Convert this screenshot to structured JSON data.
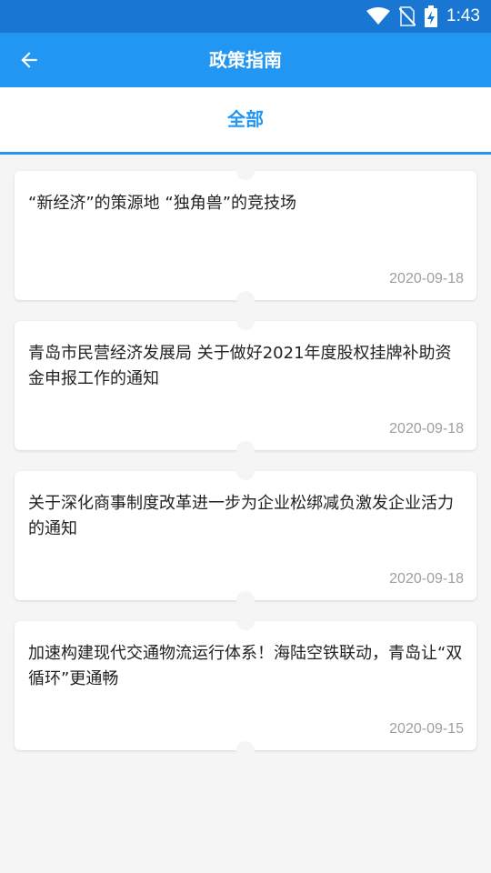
{
  "status_bar": {
    "time": "1:43"
  },
  "app_bar": {
    "title": "政策指南"
  },
  "tabs": [
    {
      "label": "全部"
    }
  ],
  "articles": [
    {
      "title": "“新经济”的策源地 “独角兽”的竞技场",
      "date": "2020-09-18"
    },
    {
      "title": "青岛市民营经济发展局 关于做好2021年度股权挂牌补助资金申报工作的通知",
      "date": "2020-09-18"
    },
    {
      "title": "关于深化商事制度改革进一步为企业松绑减负激发企业活力的通知",
      "date": "2020-09-18"
    },
    {
      "title": "加速构建现代交通物流运行体系！海陆空铁联动，青岛让“双循环”更通畅",
      "date": "2020-09-15"
    }
  ],
  "colors": {
    "status_bar": "#1976d2",
    "app_bar": "#2196f3",
    "accent": "#2196f3"
  }
}
